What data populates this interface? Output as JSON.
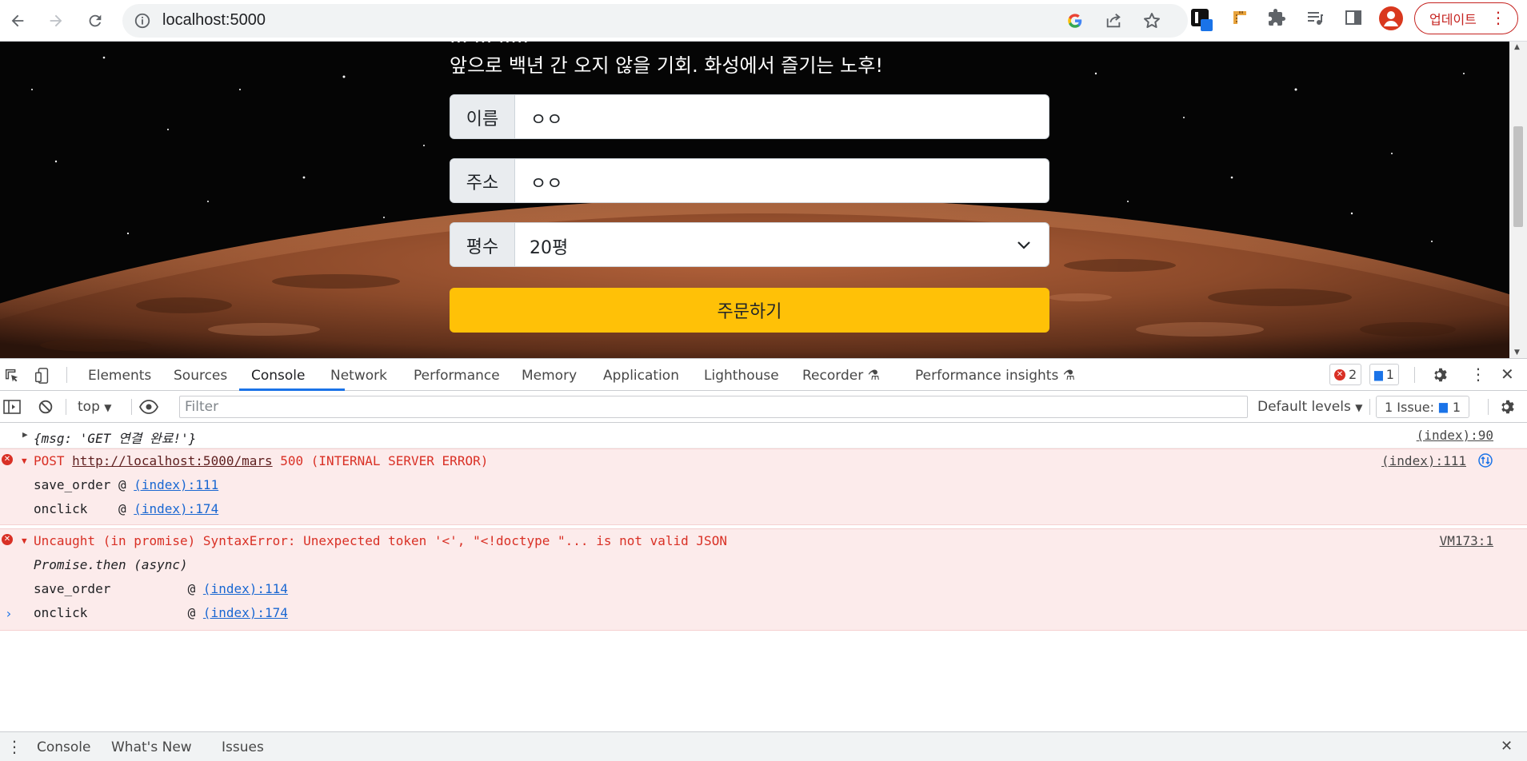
{
  "browser": {
    "url": "localhost:5000",
    "update_label": "업데이트"
  },
  "page": {
    "tagline_partial": "··· ··· ·····",
    "tagline": "앞으로 백년 간 오지 않을 기회. 화성에서 즐기는 노후!",
    "fields": [
      {
        "label": "이름",
        "value": "ㅇㅇ"
      },
      {
        "label": "주소",
        "value": "ㅇㅇ"
      },
      {
        "label": "평수",
        "value": "20평"
      }
    ],
    "order_button": "주문하기"
  },
  "devtools": {
    "tabs": [
      "Elements",
      "Sources",
      "Console",
      "Network",
      "Performance",
      "Memory",
      "Application",
      "Lighthouse",
      "Recorder",
      "Performance insights"
    ],
    "active_tab": "Console",
    "error_count": "2",
    "message_count": "1",
    "context": "top",
    "filter_placeholder": "Filter",
    "levels": "Default levels",
    "issues_label": "1 Issue:",
    "issues_count": "1",
    "console": {
      "log1": {
        "text": "{msg: 'GET 연결 완료!'}",
        "source": "(index):90"
      },
      "error1": {
        "prefix": "POST ",
        "url": "http://localhost:5000/mars",
        "suffix": " 500 (INTERNAL SERVER ERROR)",
        "source": "(index):111",
        "stack": [
          {
            "fn": "save_order @ ",
            "loc": "(index):111"
          },
          {
            "fn": "onclick    @ ",
            "loc": "(index):174"
          }
        ]
      },
      "error2": {
        "text": "Uncaught (in promise) SyntaxError: Unexpected token '<', \"<!doctype \"... is not valid JSON",
        "source": "VM173:1",
        "async": "Promise.then (async)",
        "stack": [
          {
            "fn": "save_order          @ ",
            "loc": "(index):114"
          },
          {
            "fn": "onclick             @ ",
            "loc": "(index):174"
          }
        ]
      }
    },
    "drawer_tabs": [
      "Console",
      "What's New",
      "Issues"
    ]
  }
}
